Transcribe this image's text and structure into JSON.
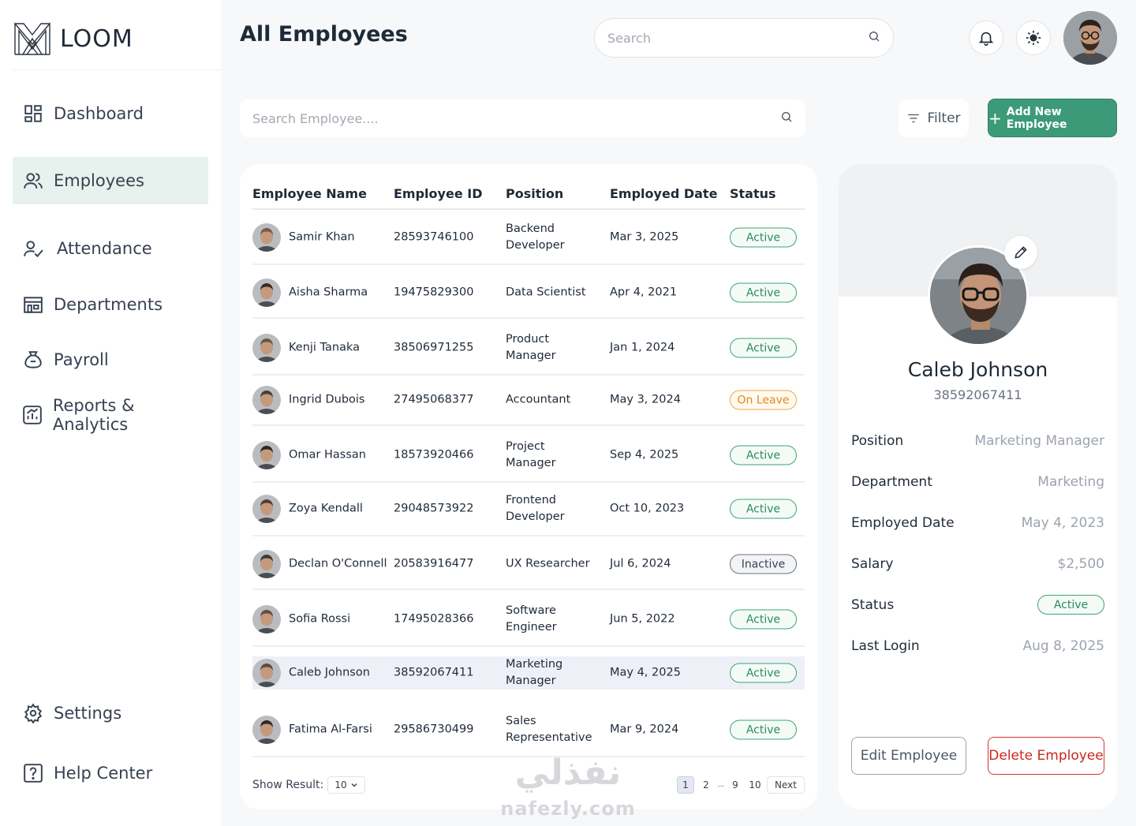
{
  "app": {
    "name": "LOOM"
  },
  "header": {
    "title": "All Employees",
    "search_placeholder": "Search"
  },
  "sidebar": {
    "items": [
      {
        "label": "Dashboard",
        "icon": "dashboard-icon"
      },
      {
        "label": "Employees",
        "icon": "users-icon",
        "active": true
      },
      {
        "label": "Attendance",
        "icon": "user-check-icon"
      },
      {
        "label": "Departments",
        "icon": "building-icon"
      },
      {
        "label": "Payroll",
        "icon": "money-bag-icon"
      },
      {
        "label": "Reports & Analytics",
        "icon": "chart-icon"
      }
    ],
    "bottom": [
      {
        "label": "Settings",
        "icon": "gear-icon"
      },
      {
        "label": "Help Center",
        "icon": "help-icon"
      }
    ]
  },
  "toolbar": {
    "employee_search_placeholder": "Search Employee....",
    "filter_label": "Filter",
    "add_label": "Add New Employee"
  },
  "table": {
    "columns": [
      "Employee Name",
      "Employee ID",
      "Position",
      "Employed Date",
      "Status"
    ],
    "rows": [
      {
        "name": "Samir Khan",
        "id": "28593746100",
        "position": [
          "Backend",
          "Developer"
        ],
        "date": "Mar 3, 2025",
        "status": "Active",
        "status_type": "active",
        "avatar_color": "#7a5a45"
      },
      {
        "name": "Aisha Sharma",
        "id": "19475829300",
        "position": [
          "Data Scientist"
        ],
        "date": "Apr 4, 2021",
        "status": "Active",
        "status_type": "active",
        "avatar_color": "#3b2a24"
      },
      {
        "name": "Kenji Tanaka",
        "id": "38506971255",
        "position": [
          "Product",
          "Manager"
        ],
        "date": "Jan 1, 2024",
        "status": "Active",
        "status_type": "active",
        "avatar_color": "#6e5646"
      },
      {
        "name": "Ingrid Dubois",
        "id": "27495068377",
        "position": [
          "Accountant"
        ],
        "date": "May 3, 2024",
        "status": "On Leave",
        "status_type": "leave",
        "avatar_color": "#4a3d34"
      },
      {
        "name": "Omar Hassan",
        "id": "18573920466",
        "position": [
          "Project",
          "Manager"
        ],
        "date": "Sep 4, 2025",
        "status": "Active",
        "status_type": "active",
        "avatar_color": "#2e2724"
      },
      {
        "name": "Zoya Kendall",
        "id": "29048573922",
        "position": [
          "Frontend",
          "Developer"
        ],
        "date": "Oct 10, 2023",
        "status": "Active",
        "status_type": "active",
        "avatar_color": "#5a3a2e"
      },
      {
        "name": "Declan O'Connell",
        "id": "20583916477",
        "position": [
          "UX Researcher"
        ],
        "date": "Jul 6, 2024",
        "status": "Inactive",
        "status_type": "inactive",
        "avatar_color": "#3d3a36"
      },
      {
        "name": "Sofia Rossi",
        "id": "17495028366",
        "position": [
          "Software",
          "Engineer"
        ],
        "date": "Jun 5, 2022",
        "status": "Active",
        "status_type": "active",
        "avatar_color": "#6b4a3a"
      },
      {
        "name": "Caleb Johnson",
        "id": "38592067411",
        "position": [
          "Marketing",
          "Manager"
        ],
        "date": "May 4, 2025",
        "status": "Active",
        "status_type": "active",
        "avatar_color": "#5e4a3e",
        "selected": true
      },
      {
        "name": "Fatima Al-Farsi",
        "id": "29586730499",
        "position": [
          "Sales",
          "Representative"
        ],
        "date": "Mar 9, 2024",
        "status": "Active",
        "status_type": "active",
        "avatar_color": "#2f2826"
      }
    ],
    "show_result_label": "Show Result:",
    "page_size": "10",
    "pages": [
      "1",
      "2",
      "...",
      "9",
      "10"
    ],
    "current_page": "1",
    "next_label": "Next"
  },
  "watermark": {
    "arabic": "نفذلي",
    "latin": "nafezly.com"
  },
  "profile": {
    "name": "Caleb Johnson",
    "id": "38592067411",
    "details": [
      {
        "label": "Position",
        "value": "Marketing Manager"
      },
      {
        "label": "Department",
        "value": "Marketing"
      },
      {
        "label": "Employed Date",
        "value": "May 4, 2023"
      },
      {
        "label": "Salary",
        "value": "$2,500"
      },
      {
        "label": "Status",
        "value": "Active",
        "badge": true
      },
      {
        "label": "Last Login",
        "value": "Aug 8, 2025"
      }
    ],
    "edit_label": "Edit Employee",
    "delete_label": "Delete Employee"
  },
  "colors": {
    "accent": "#3c9a78",
    "active_nav_bg": "#e7f2ee",
    "active_badge": "#3ba476",
    "leave_badge": "#f0a73e",
    "inactive_badge": "#6b7280",
    "delete": "#d0372d"
  }
}
